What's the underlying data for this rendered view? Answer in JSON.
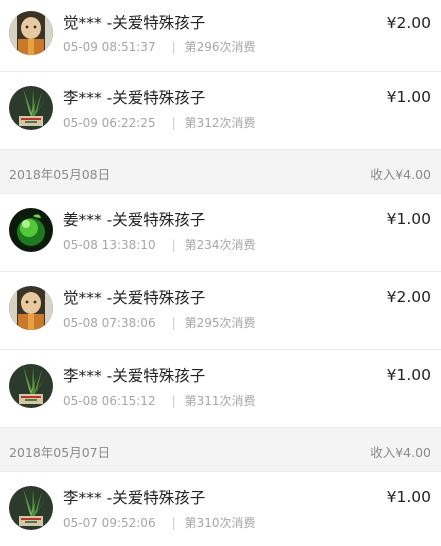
{
  "sections": [
    {
      "header": null,
      "items": [
        {
          "name": "觉*** -关爱特殊孩子",
          "time": "05-09 08:51:37",
          "count": "第296次消费",
          "amount": "¥2.00",
          "avatar": "monk-avatar-icon"
        },
        {
          "name": "李*** -关爱特殊孩子",
          "time": "05-09 06:22:25",
          "count": "第312次消费",
          "amount": "¥1.00",
          "avatar": "plant-avatar-icon"
        }
      ]
    },
    {
      "header": {
        "date": "2018年05月08日",
        "income": "收入¥4.00"
      },
      "items": [
        {
          "name": "姜*** -关爱特殊孩子",
          "time": "05-08 13:38:10",
          "count": "第234次消费",
          "amount": "¥1.00",
          "avatar": "jade-avatar-icon"
        },
        {
          "name": "觉*** -关爱特殊孩子",
          "time": "05-08 07:38:06",
          "count": "第295次消费",
          "amount": "¥2.00",
          "avatar": "monk-avatar-icon"
        },
        {
          "name": "李*** -关爱特殊孩子",
          "time": "05-08 06:15:12",
          "count": "第311次消费",
          "amount": "¥1.00",
          "avatar": "plant-avatar-icon"
        }
      ]
    },
    {
      "header": {
        "date": "2018年05月07日",
        "income": "收入¥4.00"
      },
      "items": [
        {
          "name": "李*** -关爱特殊孩子",
          "time": "05-07 09:52:06",
          "count": "第310次消费",
          "amount": "¥1.00",
          "avatar": "plant-avatar-icon"
        }
      ]
    }
  ]
}
